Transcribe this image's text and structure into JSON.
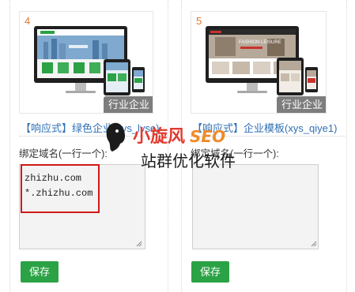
{
  "cards": [
    {
      "number": "4",
      "category": "行业企业",
      "title": "【响应式】绿色企业(xys_lvse)",
      "domain_label": "绑定域名(一行一个):",
      "domains": "zhizhu.com\n*.zhizhu.com",
      "save_label": "保存"
    },
    {
      "number": "5",
      "category": "行业企业",
      "title": "【响应式】企业模板(xys_qiye1)",
      "domain_label": "绑定域名(一行一个):",
      "domains": "",
      "save_label": "保存",
      "preview_banner": "FASHION LEISURE"
    }
  ],
  "watermark": {
    "brand_logo_text": "小旋风SEO",
    "caption": "站群优化软件"
  },
  "colors": {
    "accent_orange": "#e0752b",
    "link_blue": "#2f6fb5",
    "save_green": "#2ba245",
    "highlight_red": "#d01818"
  }
}
